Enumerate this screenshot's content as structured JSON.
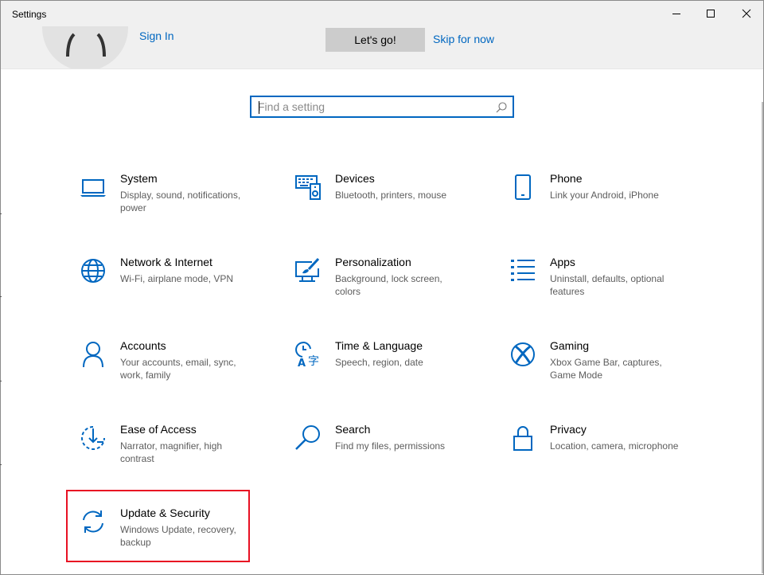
{
  "window": {
    "title": "Settings",
    "controls": [
      "minimize",
      "maximize",
      "close"
    ]
  },
  "banner": {
    "sign_in_label": "Sign In",
    "lets_go_label": "Let's go!",
    "skip_label": "Skip for now"
  },
  "search": {
    "placeholder": "Find a setting",
    "value": ""
  },
  "colors": {
    "accent": "#0067c0",
    "highlight": "#e81123"
  },
  "categories": [
    {
      "name": "System",
      "description": "Display, sound, notifications, power",
      "icon": "laptop-icon"
    },
    {
      "name": "Devices",
      "description": "Bluetooth, printers, mouse",
      "icon": "devices-icon"
    },
    {
      "name": "Phone",
      "description": "Link your Android, iPhone",
      "icon": "phone-icon"
    },
    {
      "name": "Network & Internet",
      "description": "Wi-Fi, airplane mode, VPN",
      "icon": "globe-icon"
    },
    {
      "name": "Personalization",
      "description": "Background, lock screen, colors",
      "icon": "paintbrush-icon"
    },
    {
      "name": "Apps",
      "description": "Uninstall, defaults, optional features",
      "icon": "apps-list-icon"
    },
    {
      "name": "Accounts",
      "description": "Your accounts, email, sync, work, family",
      "icon": "person-icon"
    },
    {
      "name": "Time & Language",
      "description": "Speech, region, date",
      "icon": "time-language-icon"
    },
    {
      "name": "Gaming",
      "description": "Xbox Game Bar, captures, Game Mode",
      "icon": "xbox-icon"
    },
    {
      "name": "Ease of Access",
      "description": "Narrator, magnifier, high contrast",
      "icon": "ease-of-access-icon"
    },
    {
      "name": "Search",
      "description": "Find my files, permissions",
      "icon": "magnifier-icon"
    },
    {
      "name": "Privacy",
      "description": "Location, camera, microphone",
      "icon": "lock-icon"
    },
    {
      "name": "Update & Security",
      "description": "Windows Update, recovery, backup",
      "icon": "refresh-icon"
    }
  ]
}
